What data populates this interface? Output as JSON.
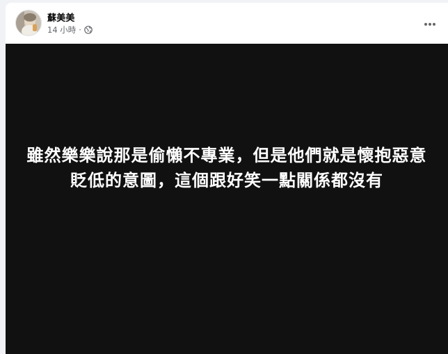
{
  "post": {
    "author": "蘇美美",
    "time": "14 小時",
    "separator": "·",
    "privacy_icon": "globe-icon",
    "more_icon": "more-options-icon",
    "text": "雖然樂樂說那是偷懶不專業，但是他們就是懷抱惡意貶低的意圖，這個跟好笑一點關係都沒有",
    "background_color": "#111111",
    "text_color": "#ffffff"
  }
}
